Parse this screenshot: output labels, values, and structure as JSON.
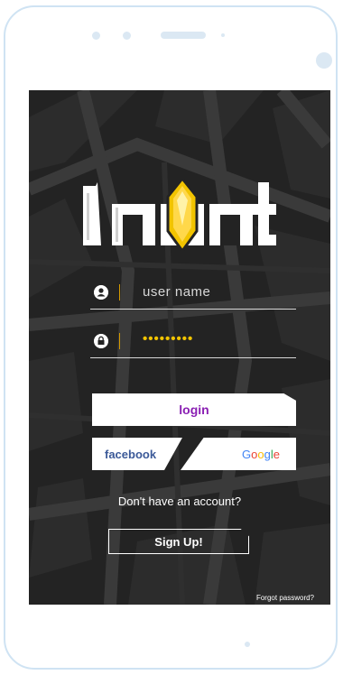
{
  "app": {
    "logo_text": "loot"
  },
  "form": {
    "username_placeholder": "user name",
    "password_value": "•••••••••",
    "username_icon": "user-icon",
    "password_icon": "lock-icon"
  },
  "buttons": {
    "login_label": "login",
    "facebook_label": "facebook",
    "google_label": "Google",
    "signup_label": "Sign Up!"
  },
  "text": {
    "no_account": "Don't have an account?",
    "forgot_password": "Forgot password?"
  },
  "colors": {
    "background": "#232323",
    "accent_gold": "#f2c400",
    "login_purple": "#8a1fb3",
    "facebook_blue": "#3b5998"
  }
}
